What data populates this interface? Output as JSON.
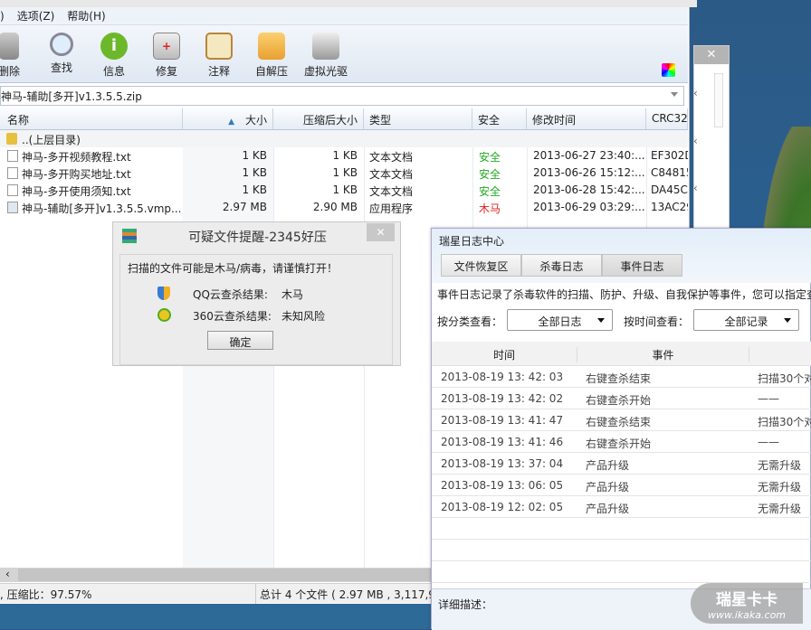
{
  "archive_window": {
    "menu": [
      ") ",
      "选项(Z)",
      "帮助(H)"
    ],
    "toolbar": [
      {
        "label": "删除",
        "icon": "trash-icon"
      },
      {
        "label": "查找",
        "icon": "magnifier-icon"
      },
      {
        "label": "信息",
        "icon": "info-icon"
      },
      {
        "label": "修复",
        "icon": "repair-kit-icon"
      },
      {
        "label": "注释",
        "icon": "notepad-icon"
      },
      {
        "label": "自解压",
        "icon": "folder-up-icon"
      },
      {
        "label": "虚拟光驱",
        "icon": "virtual-drive-icon"
      }
    ],
    "path": "神马-辅助[多开]v1.3.5.5.zip",
    "columns": [
      "名称",
      "大小",
      "压缩后大小",
      "类型",
      "安全",
      "修改时间",
      "CRC32"
    ],
    "parent_dir": "..(上层目录)",
    "files": [
      {
        "name": "神马-多开视频教程.txt",
        "size": "1 KB",
        "packed": "1 KB",
        "type": "文本文档",
        "safety": "安全",
        "modified": "2013-06-27 23:40:...",
        "crc": "EF302D"
      },
      {
        "name": "神马-多开购买地址.txt",
        "size": "1 KB",
        "packed": "1 KB",
        "type": "文本文档",
        "safety": "安全",
        "modified": "2013-06-26 15:12:...",
        "crc": "C84815"
      },
      {
        "name": "神马-多开使用须知.txt",
        "size": "1 KB",
        "packed": "1 KB",
        "type": "文本文档",
        "safety": "安全",
        "modified": "2013-06-28 15:42:...",
        "crc": "DA45C"
      },
      {
        "name": "神马-辅助[多开]v1.3.5.5.vmp....",
        "size": "2.97 MB",
        "packed": "2.90 MB",
        "type": "应用程序",
        "safety": "木马",
        "modified": "2013-06-29 03:29:...",
        "crc": "13AC29"
      }
    ],
    "status_left": ", 压缩比：97.57%",
    "status_right": "总计 4 个文件 ( 2.97 MB , 3,117,9"
  },
  "colors": {
    "safe": "#22aa22",
    "trojan": "#dd2222"
  },
  "alert": {
    "title": "可疑文件提醒-2345好压",
    "message": "扫描的文件可能是木马/病毒，请谨慎打开！",
    "qq_label": "QQ云查杀结果:",
    "qq_value": "木马",
    "s360_label": "360云查杀结果:",
    "s360_value": "未知风险",
    "ok": "确定"
  },
  "log": {
    "title": "瑞星日志中心",
    "tabs": [
      "文件恢复区",
      "杀毒日志",
      "事件日志"
    ],
    "description": "事件日志记录了杀毒软件的扫描、防护、升级、自我保护等事件，您可以指定查",
    "category_label": "按分类查看：",
    "category_value": "全部日志",
    "time_label": "按时间查看：",
    "time_value": "全部记录",
    "columns": [
      "时间",
      "事件"
    ],
    "rows": [
      {
        "time": "2013-08-19 13: 42: 03",
        "event": "右键查杀结束",
        "detail": "扫描30个对"
      },
      {
        "time": "2013-08-19 13: 42: 02",
        "event": "右键查杀开始",
        "detail": "——"
      },
      {
        "time": "2013-08-19 13: 41: 47",
        "event": "右键查杀结束",
        "detail": "扫描30个对"
      },
      {
        "time": "2013-08-19 13: 41: 46",
        "event": "右键查杀开始",
        "detail": "——"
      },
      {
        "time": "2013-08-19 13: 37: 04",
        "event": "产品升级",
        "detail": "无需升级"
      },
      {
        "time": "2013-08-19 13: 06: 05",
        "event": "产品升级",
        "detail": "无需升级"
      },
      {
        "time": "2013-08-19 12: 02: 05",
        "event": "产品升级",
        "detail": "无需升级"
      }
    ],
    "detail_label": "详细描述："
  },
  "watermark": {
    "brand": "瑞星卡卡",
    "url": "www.ikaka.com"
  }
}
